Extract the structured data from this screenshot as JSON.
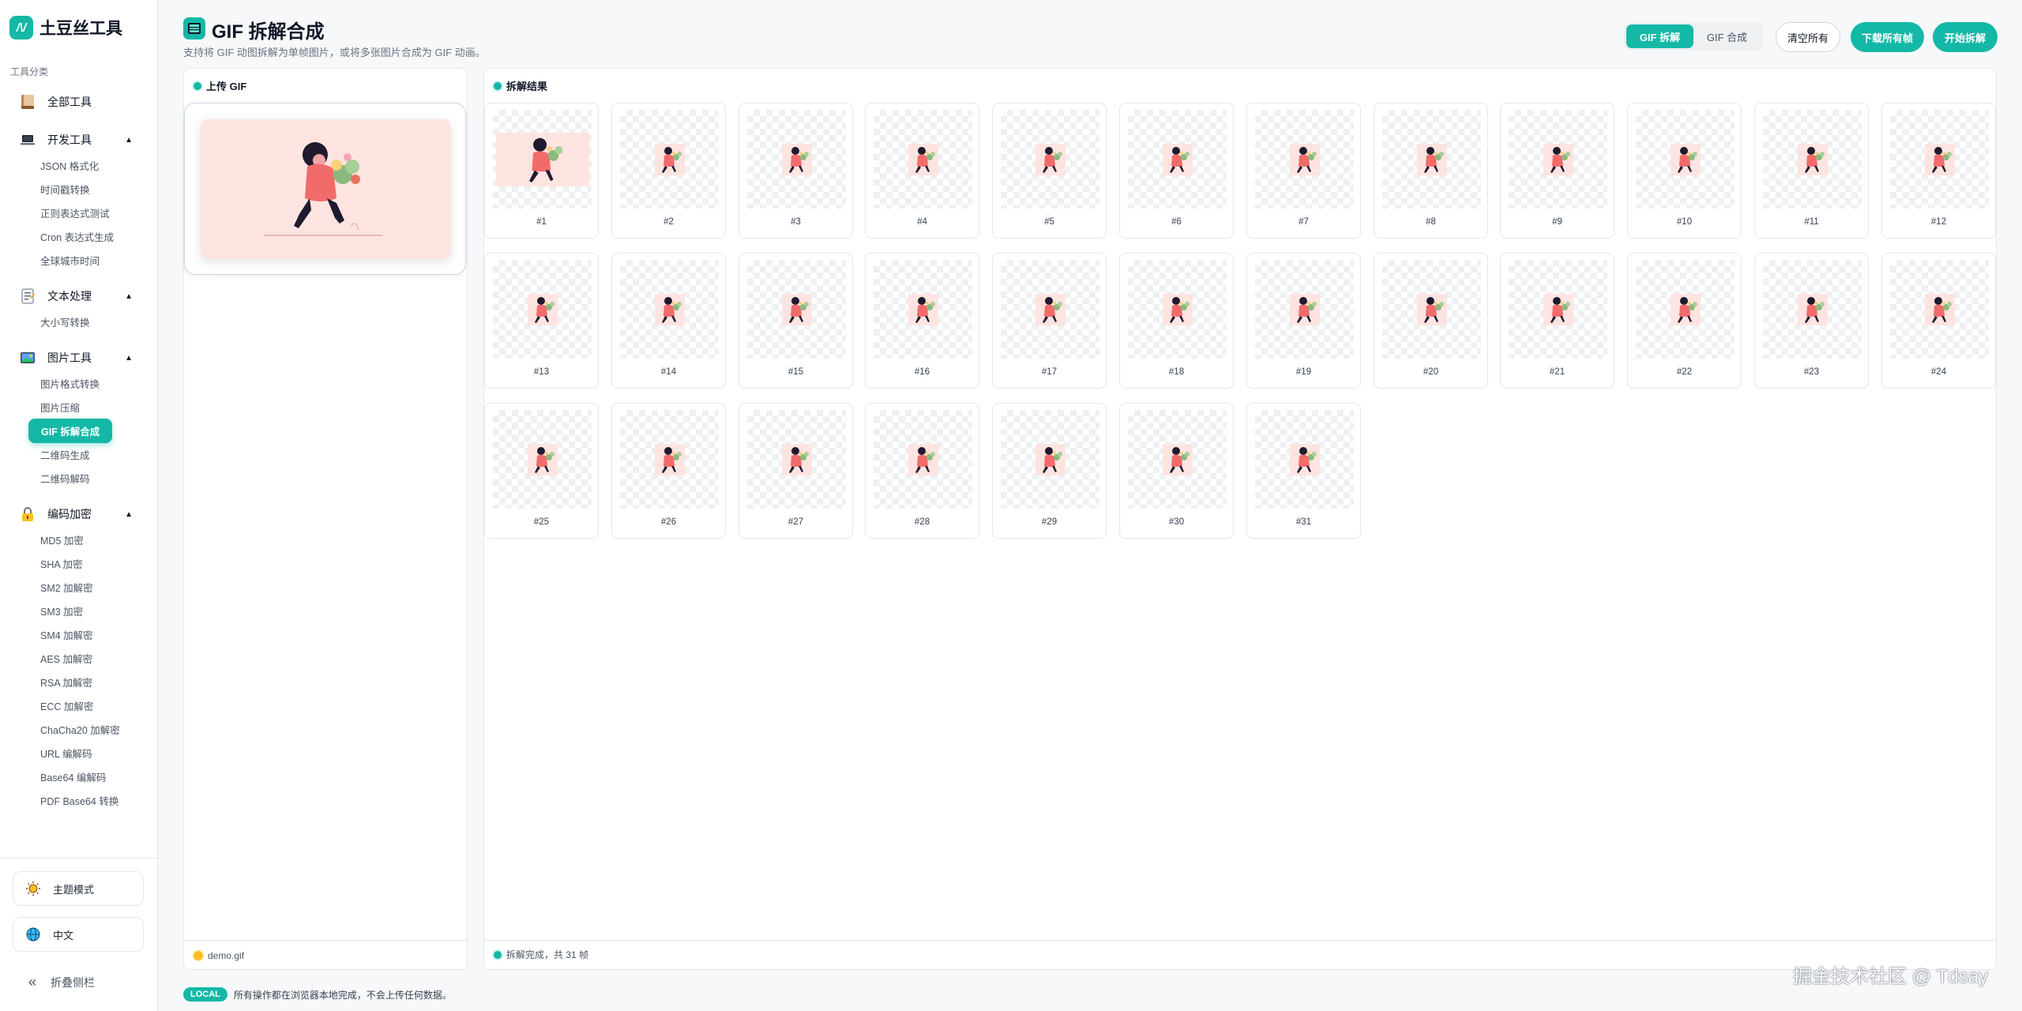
{
  "brand": {
    "name": "土豆丝工具",
    "logo_text": "/\\/"
  },
  "sidebar": {
    "category_label": "工具分类",
    "all_tools": "全部工具",
    "groups": [
      {
        "label": "开发工具",
        "icon": "laptop-icon",
        "items": [
          "JSON 格式化",
          "时间戳转换",
          "正则表达式测试",
          "Cron 表达式生成",
          "全球城市时间"
        ]
      },
      {
        "label": "文本处理",
        "icon": "document-icon",
        "items": [
          "大小写转换"
        ]
      },
      {
        "label": "图片工具",
        "icon": "image-icon",
        "items": [
          "图片格式转换",
          "图片压缩",
          "GIF 拆解合成",
          "二维码生成",
          "二维码解码"
        ]
      },
      {
        "label": "编码加密",
        "icon": "lock-icon",
        "items": [
          "MD5 加密",
          "SHA 加密",
          "SM2 加解密",
          "SM3 加密",
          "SM4 加解密",
          "AES 加解密",
          "RSA 加解密",
          "ECC 加解密",
          "ChaCha20 加解密",
          "URL 编解码",
          "Base64 编解码",
          "PDF Base64 转换"
        ]
      }
    ],
    "active_item": "GIF 拆解合成",
    "theme_label": "主题模式",
    "lang_label": "中文",
    "collapse_label": "折叠侧栏",
    "collapse_icon": "«"
  },
  "header": {
    "title": "GIF 拆解合成",
    "subtitle": "支持将 GIF 动图拆解为单帧图片，或将多张图片合成为 GIF 动画。",
    "mode_split": "GIF 拆解",
    "mode_merge": "GIF 合成",
    "clear_all": "清空所有",
    "download_all": "下载所有帧",
    "start": "开始拆解"
  },
  "upload": {
    "title": "上传 GIF",
    "file_name": "demo.gif"
  },
  "result": {
    "title": "拆解结果",
    "status": "拆解完成，共 31 帧",
    "frames": [
      "#1",
      "#2",
      "#3",
      "#4",
      "#5",
      "#6",
      "#7",
      "#8",
      "#9",
      "#10",
      "#11",
      "#12",
      "#13",
      "#14",
      "#15",
      "#16",
      "#17",
      "#18",
      "#19",
      "#20",
      "#21",
      "#22",
      "#23",
      "#24",
      "#25",
      "#26",
      "#27",
      "#28",
      "#29",
      "#30",
      "#31"
    ]
  },
  "footer": {
    "badge": "LOCAL",
    "note": "所有操作都在浏览器本地完成，不会上传任何数据。"
  },
  "watermark": "掘金技术社区 @ Tdsay",
  "colors": {
    "accent": "#14b8a6",
    "preview_bg": "#fde4e1"
  }
}
